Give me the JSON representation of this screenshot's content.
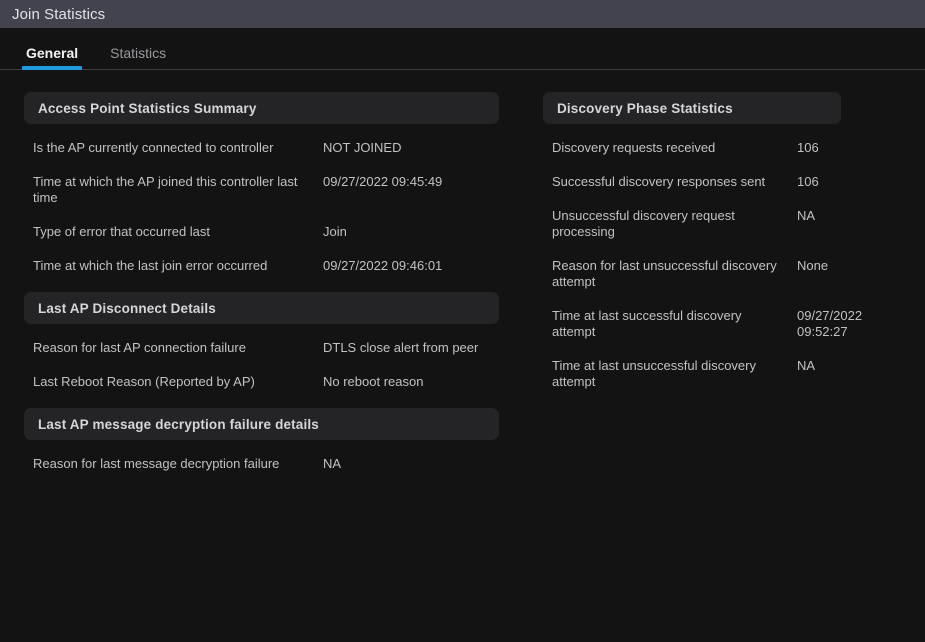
{
  "window": {
    "title": "Join Statistics"
  },
  "tabs": [
    {
      "label": "General",
      "active": true
    },
    {
      "label": "Statistics",
      "active": false
    }
  ],
  "colors": {
    "titlebar_bg": "#434350",
    "page_bg": "#131314",
    "section_header_bg": "#242426",
    "accent": "#1f9bde",
    "text": "#c2c2c4",
    "divider": "#3c3c3e"
  },
  "left_column": {
    "sections": [
      {
        "title": "Access Point Statistics Summary",
        "rows": [
          {
            "label": "Is the AP currently connected to controller",
            "value": "NOT JOINED"
          },
          {
            "label": "Time at which the AP joined this controller last time",
            "value": "09/27/2022 09:45:49"
          },
          {
            "label": "Type of error that occurred last",
            "value": "Join"
          },
          {
            "label": "Time at which the last join error occurred",
            "value": "09/27/2022 09:46:01"
          }
        ]
      },
      {
        "title": "Last AP Disconnect Details",
        "rows": [
          {
            "label": "Reason for last AP connection failure",
            "value": "DTLS close alert from peer"
          },
          {
            "label": "Last Reboot Reason (Reported by AP)",
            "value": "No reboot reason"
          }
        ]
      },
      {
        "title": "Last AP message decryption failure details",
        "rows": [
          {
            "label": "Reason for last message decryption failure",
            "value": "NA"
          }
        ]
      }
    ]
  },
  "right_column": {
    "sections": [
      {
        "title": "Discovery Phase Statistics",
        "rows": [
          {
            "label": "Discovery requests received",
            "value": "106"
          },
          {
            "label": "Successful discovery responses sent",
            "value": "106"
          },
          {
            "label": "Unsuccessful discovery request processing",
            "value": "NA"
          },
          {
            "label": "Reason for last unsuccessful discovery attempt",
            "value": "None"
          },
          {
            "label": "Time at last successful discovery attempt",
            "value": "09/27/2022 09:52:27"
          },
          {
            "label": "Time at last unsuccessful discovery attempt",
            "value": "NA"
          }
        ]
      }
    ]
  }
}
